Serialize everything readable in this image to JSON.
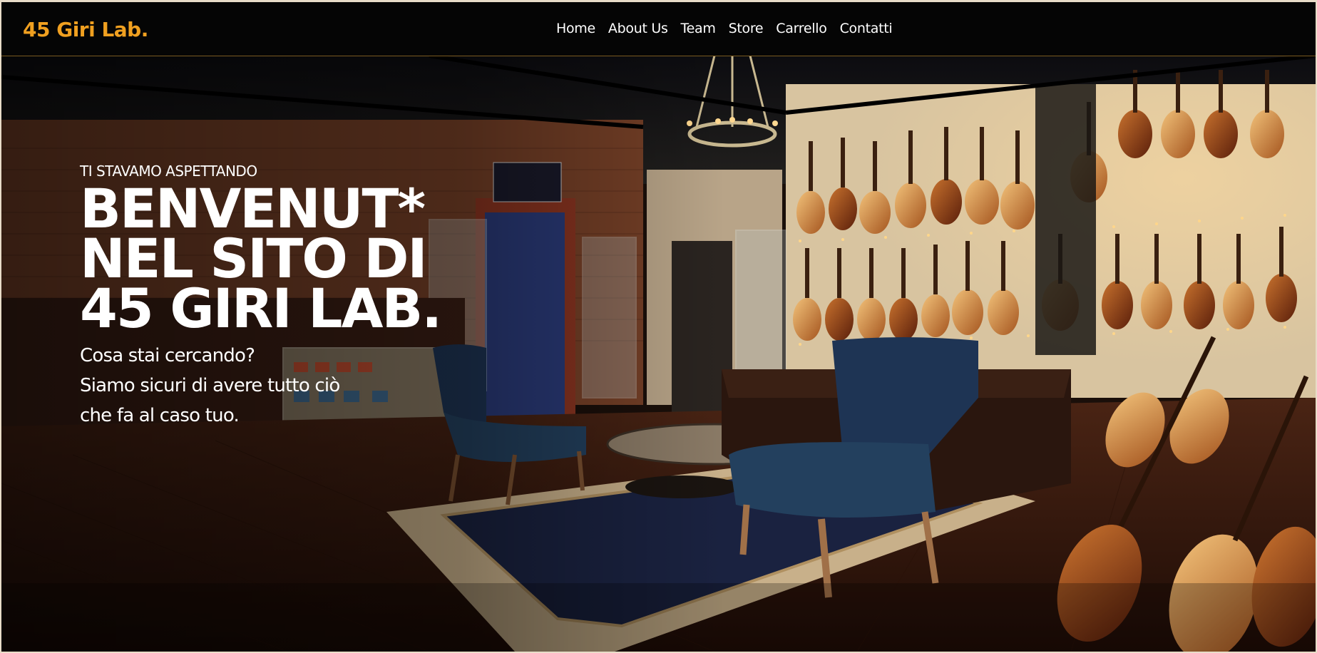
{
  "site": {
    "logo": "45 Giri Lab."
  },
  "nav": {
    "items": [
      {
        "label": "Home"
      },
      {
        "label": "About Us"
      },
      {
        "label": "Team"
      },
      {
        "label": "Store"
      },
      {
        "label": "Carrello"
      },
      {
        "label": "Contatti"
      }
    ]
  },
  "hero": {
    "kicker": "TI STAVAMO ASPETTANDO",
    "headline": "BENVENUT* NEL SITO DI 45 GIRI LAB.",
    "subtext_lines": [
      "Cosa stai cercando?",
      "Siamo sicuri di avere tutto ciò",
      "che fa al caso tuo."
    ]
  },
  "colors": {
    "accent": "#f0a020",
    "navbar_bg": "#050505",
    "text": "#ffffff"
  }
}
